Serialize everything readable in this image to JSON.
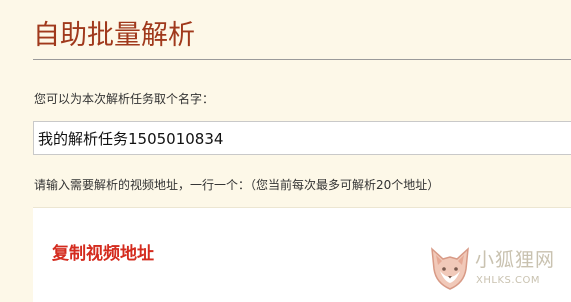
{
  "page": {
    "title": "自助批量解析"
  },
  "task_name": {
    "label": "您可以为本次解析任务取个名字：",
    "value": "我的解析任务1505010834"
  },
  "video_urls": {
    "label": "请输入需要解析的视频地址，一行一个：（您当前每次最多可解析20个地址）",
    "content": "复制视频地址"
  },
  "watermark": {
    "site_name": "小狐狸网",
    "domain": "XHLKS.COM",
    "logo_icon": "fox-head-icon"
  },
  "colors": {
    "background": "#fdf8e8",
    "title": "#a0391c",
    "highlight_text": "#d42b1e",
    "watermark": "#c9c2b0"
  }
}
